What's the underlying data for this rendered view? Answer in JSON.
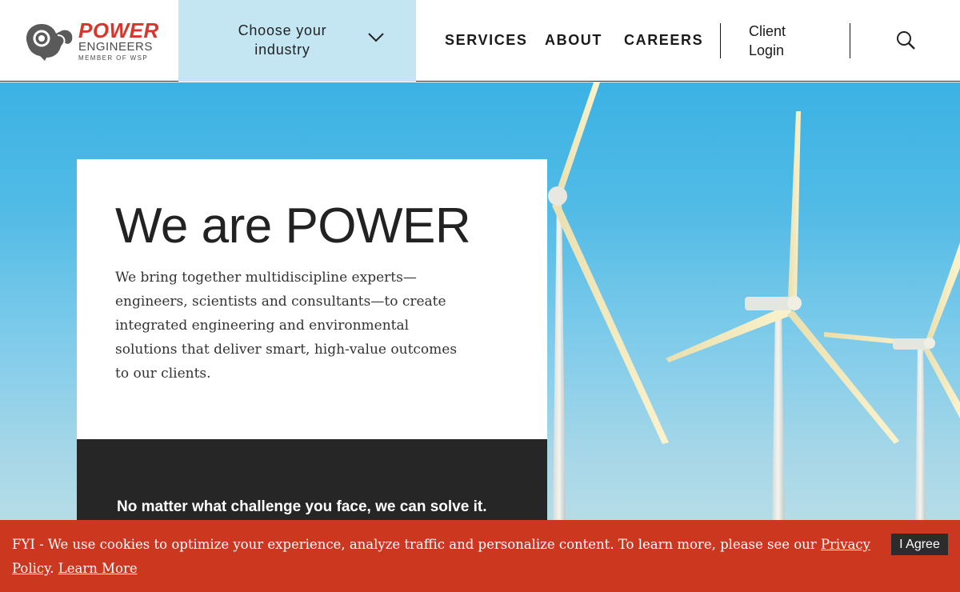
{
  "brand": {
    "name": "POWER",
    "subname": "ENGINEERS",
    "tagline": "MEMBER OF WSP",
    "primary_color": "#d9362b"
  },
  "header": {
    "industry_label": "Choose your industry",
    "nav": [
      "SERVICES",
      "ABOUT",
      "CAREERS"
    ],
    "client_login": "Client Login",
    "search_icon": "search-icon",
    "industry_bg_color": "#c4e6f3"
  },
  "hero": {
    "title": "We are POWER",
    "description": "We bring together multidiscipline experts—engineers, scientists and consultants—to create integrated engineering and environmental solutions that deliver smart, high-value outcomes to our clients.",
    "tagline": "No matter what challenge you face, we can solve it."
  },
  "cookie": {
    "text": "FYI - We use cookies to optimize your experience, analyze traffic and personalize content. To learn more, please see our ",
    "privacy_link": "Privacy Policy",
    "learn_more": "Learn More",
    "agree_button": "I Agree",
    "bar_color": "#cc3720"
  }
}
